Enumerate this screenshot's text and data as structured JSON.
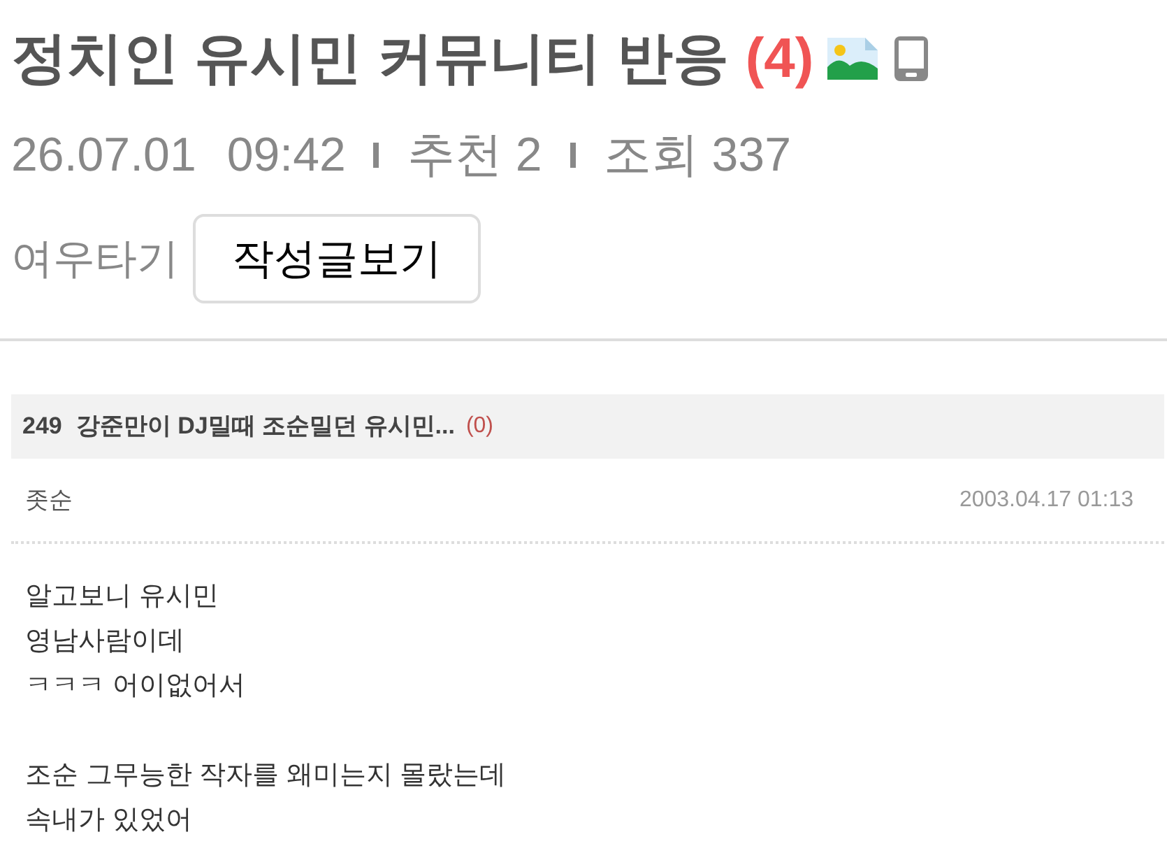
{
  "post": {
    "title": "정치인 유시민 커뮤니티 반응",
    "comment_count": "(4)",
    "has_image": true,
    "posted_from_mobile": true
  },
  "meta": {
    "date": "26.07.01",
    "time": "09:42",
    "recommend": "추천 2",
    "views": "조회 337"
  },
  "author": {
    "name": "여우타기",
    "posts_button": "작성글보기"
  },
  "quoted_post": {
    "number": "249",
    "title": "강준만이 DJ밀때 조순밀던 유시민...",
    "comment_count": "(0)",
    "author": "좃순",
    "date": "2003.04.17 01:13",
    "paragraphs": [
      "알고보니 유시민\n영남사람이데\nㅋㅋㅋ 어이없어서",
      "조순 그무능한 작자를 왜미는지 몰랐는데\n속내가 있었어"
    ]
  }
}
